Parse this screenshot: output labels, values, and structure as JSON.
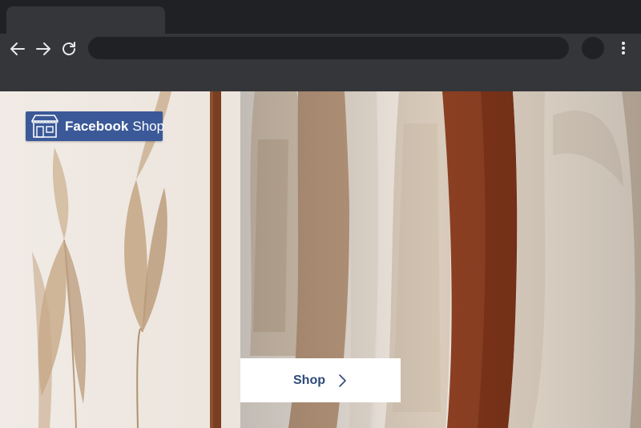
{
  "browser": {
    "tab_title": "",
    "url": "",
    "icons": {
      "back": "back-arrow-icon",
      "forward": "forward-arrow-icon",
      "reload": "reload-icon",
      "profile": "profile-avatar",
      "menu": "kebab-menu-icon"
    }
  },
  "hero": {
    "logo": {
      "brand": "Facebook",
      "product": "Shop",
      "icon": "storefront-icon",
      "color": "#3b5998"
    },
    "shop_button": {
      "label": "Shop",
      "icon": "chevron-right-icon",
      "text_color": "#2f4a7a"
    }
  }
}
